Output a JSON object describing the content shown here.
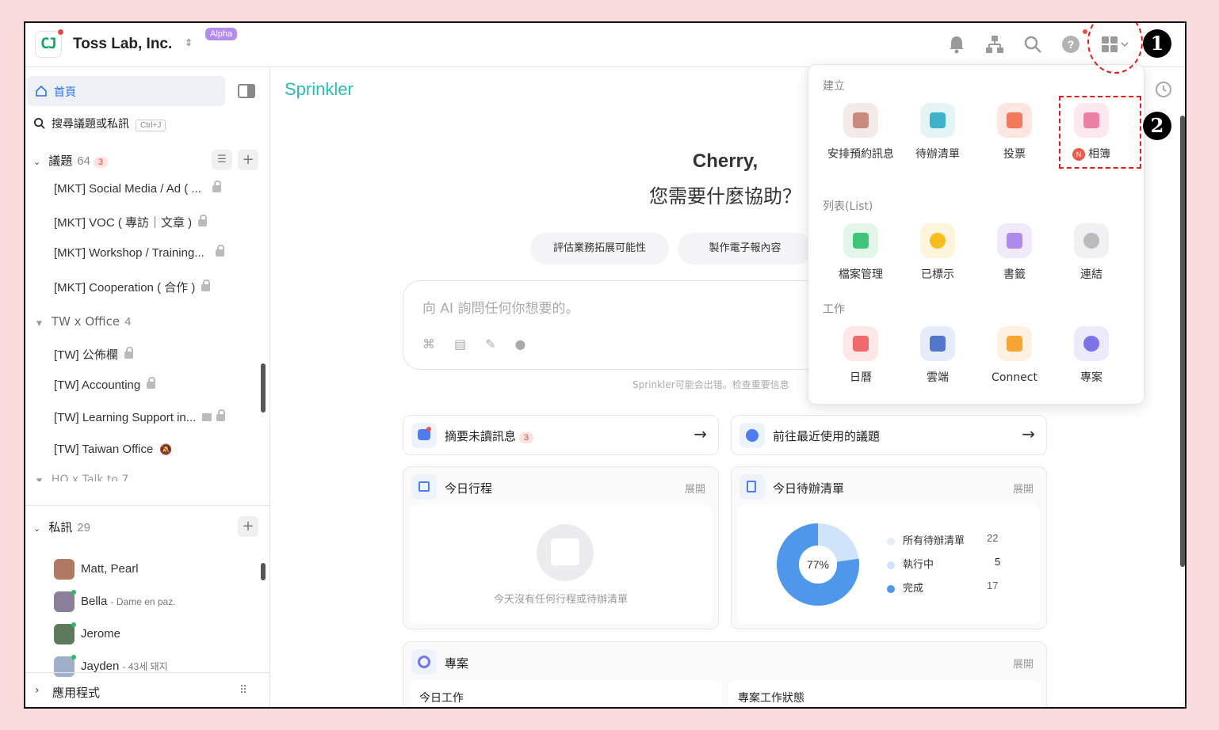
{
  "header": {
    "team_name": "Toss Lab, Inc.",
    "alpha_badge": "Alpha"
  },
  "sidebar": {
    "home_label": "首頁",
    "search_label": "搜尋議題或私訊",
    "search_shortcut": "Ctrl+J",
    "topics": {
      "label": "議題",
      "count": "64",
      "unread": "3",
      "items": [
        "[MKT] Social Media / Ad ( ...",
        "[MKT] VOC ( 專訪｜文章 )",
        "[MKT] Workshop / Training...",
        "[MKT] Cooperation ( 合作 )"
      ]
    },
    "folder_tw": {
      "label": "TW x Office",
      "count": "4",
      "items": [
        "[TW] 公佈欄",
        "[TW] Accounting",
        "[TW] Learning Support in...",
        "[TW] Taiwan Office"
      ]
    },
    "folder_hq_partial": "HQ x Talk to 7",
    "dms": {
      "label": "私訊",
      "count": "29",
      "items": [
        {
          "name": "Matt, Pearl",
          "status": ""
        },
        {
          "name": "Bella",
          "status": "- Dame en paz."
        },
        {
          "name": "Jerome",
          "status": ""
        },
        {
          "name": "Jayden",
          "status": "- 43세 돼지"
        }
      ]
    },
    "apps_label": "應用程式"
  },
  "main": {
    "brand": "Sprinkler",
    "greeting_name": "Cherry,",
    "greeting_question": "您需要什麼協助？",
    "suggestion_chips": [
      "評估業務拓展可能性",
      "製作電子報內容"
    ],
    "ai_placeholder": "向 AI 詢問任何你想要的。",
    "disclaimer": "Sprinkler可能会出错。检查重要信息",
    "summary_card": {
      "label": "摘要未讀訊息",
      "badge": "3"
    },
    "recent_card": {
      "label": "前往最近使用的議題"
    },
    "schedule_card": {
      "title": "今日行程",
      "expand": "展開",
      "empty": "今天沒有任何行程或待辦清單"
    },
    "todo_card": {
      "title": "今日待辦清單",
      "expand": "展開",
      "center_label": "77%",
      "legend": [
        {
          "label": "所有待辦清單",
          "value": "22",
          "color": "#e8ecf4"
        },
        {
          "label": "執行中",
          "value": "5",
          "color": "#cfe3fb"
        },
        {
          "label": "完成",
          "value": "17",
          "color": "#4f97ea"
        }
      ]
    },
    "project_card": {
      "title": "專案",
      "expand": "展開",
      "col1": "今日工作",
      "col2": "專案工作狀態"
    }
  },
  "chart_data": {
    "type": "pie",
    "categories": [
      "執行中",
      "完成"
    ],
    "values": [
      5,
      17
    ],
    "total": 22,
    "title": ""
  },
  "popup": {
    "section_create": "建立",
    "create_items": [
      {
        "label": "安排預約訊息",
        "color": "#f4ebe8",
        "accent": "#c98a80"
      },
      {
        "label": "待辦清單",
        "color": "#e3f5f7",
        "accent": "#3cb3c9"
      },
      {
        "label": "投票",
        "color": "#fde6e1",
        "accent": "#f07a5a"
      },
      {
        "label": "相簿",
        "color": "#fde8ef",
        "accent": "#f07ea4",
        "badge": "N"
      }
    ],
    "section_list": "列表(List)",
    "list_items": [
      {
        "label": "檔案管理",
        "color": "#e3f6ea",
        "accent": "#3ec57a"
      },
      {
        "label": "已標示",
        "color": "#fff4dc",
        "accent": "#f7bd20"
      },
      {
        "label": "書籤",
        "color": "#f1eafb",
        "accent": "#b08ae8"
      },
      {
        "label": "連結",
        "color": "#f1f1f3",
        "accent": "#bbbbbb"
      }
    ],
    "section_work": "工作",
    "work_items": [
      {
        "label": "日曆",
        "color": "#fde7e7",
        "accent": "#ef6a6a"
      },
      {
        "label": "雲端",
        "color": "#e6edfa",
        "accent": "#5577c9"
      },
      {
        "label": "Connect",
        "color": "#fff0e0",
        "accent": "#f6a532"
      },
      {
        "label": "專案",
        "color": "#ecebfb",
        "accent": "#7b73e8"
      }
    ]
  },
  "annotations": {
    "step1": "1",
    "step2": "2"
  }
}
